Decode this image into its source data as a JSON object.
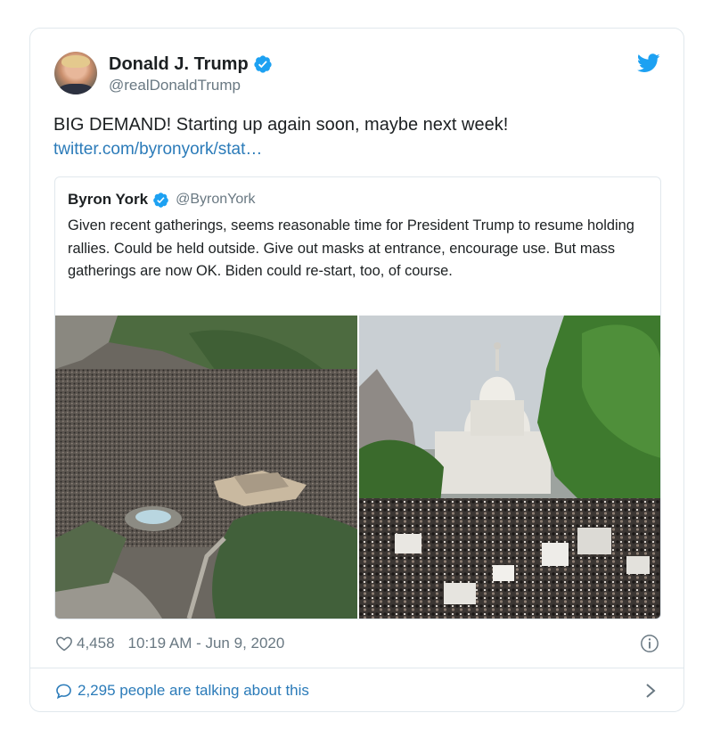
{
  "tweet": {
    "author": {
      "display_name": "Donald J. Trump",
      "handle": "@realDonaldTrump",
      "verified_icon": "verified-badge-icon",
      "avatar_icon": "avatar"
    },
    "text": "BIG DEMAND! Starting up again soon, maybe next week!",
    "link": "twitter.com/byronyork/stat…",
    "quoted": {
      "display_name": "Byron York",
      "handle": "@ByronYork",
      "text": "Given recent gatherings, seems reasonable time for President Trump to resume holding rallies. Could be held outside. Give out masks at entrance, encourage use. But mass gatherings are now OK. Biden could re-start, too, of course.",
      "photos": [
        {
          "icon": "aerial-crowd-photo"
        },
        {
          "icon": "capitol-crowd-photo"
        }
      ]
    },
    "likes": "4,458",
    "timestamp": "10:19 AM - Jun 9, 2020",
    "talking": "2,295 people are talking about this"
  },
  "colors": {
    "link": "#2b7bb9",
    "verified": "#1da1f2",
    "muted": "#697882",
    "border": "#e1e8ed"
  },
  "icons": [
    "twitter-bird-icon",
    "heart-icon",
    "info-icon",
    "speech-bubble-icon",
    "chevron-right-icon"
  ]
}
